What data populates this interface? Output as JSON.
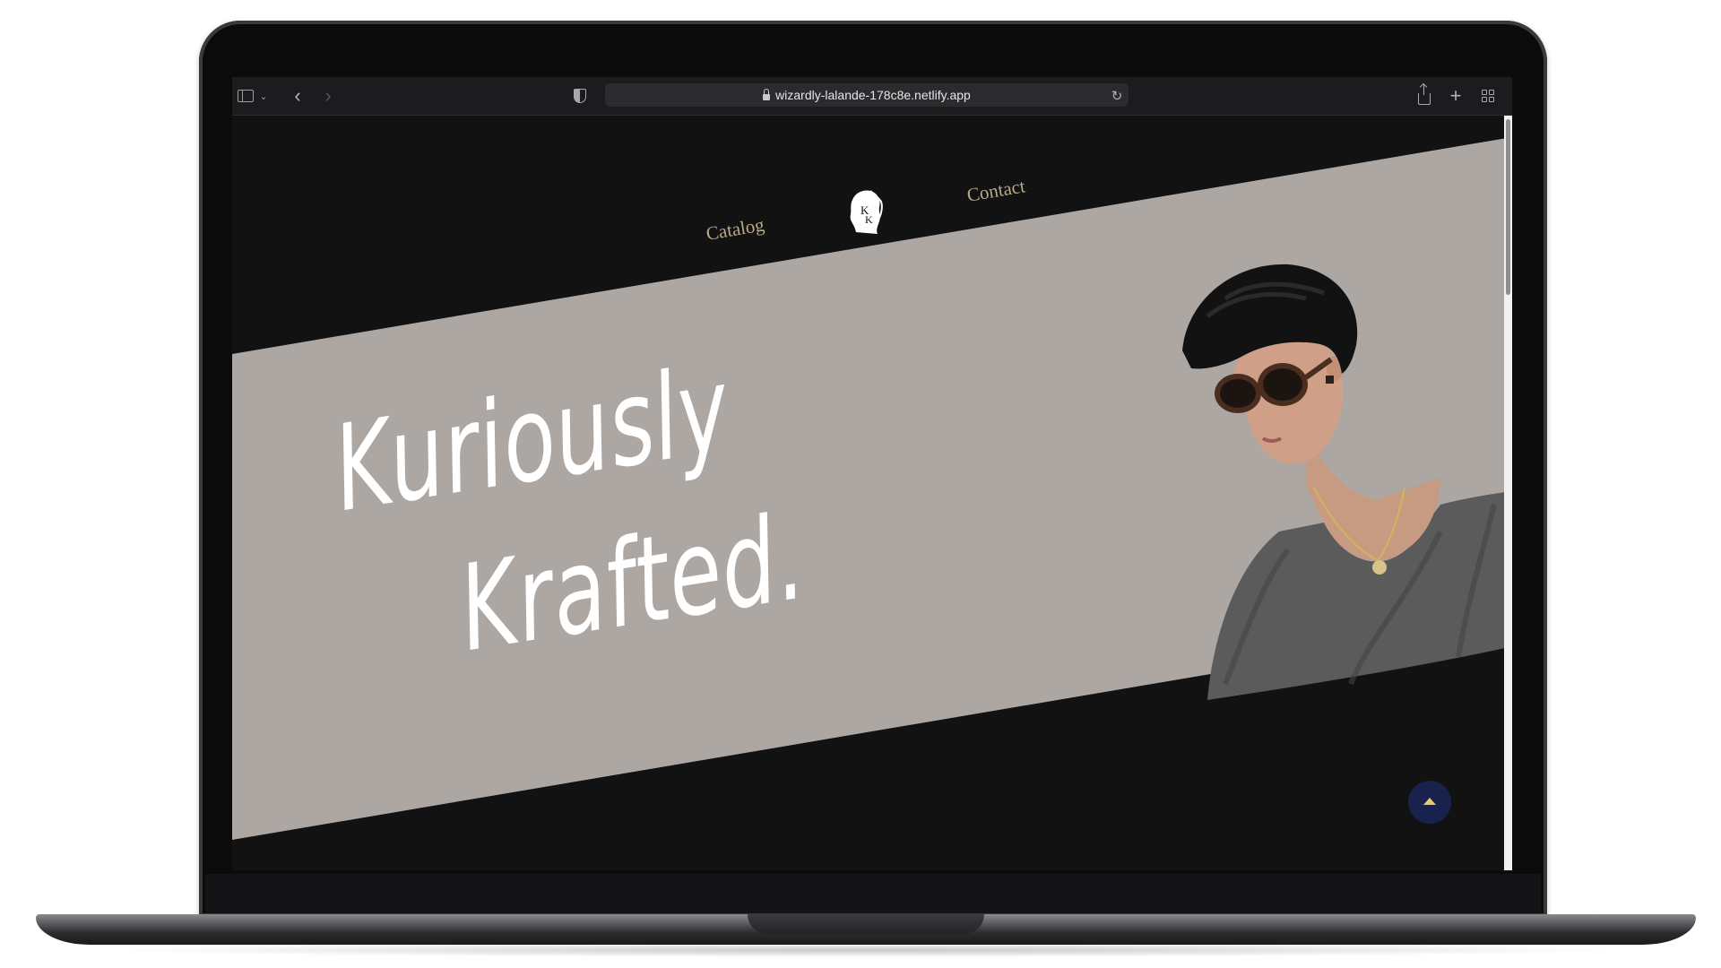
{
  "browser": {
    "url": "wizardly-lalande-178c8e.netlify.app",
    "icons": {
      "sidebar": "sidebar-icon",
      "sidebar_menu": "chevron-down-icon",
      "back": "chevron-left-icon",
      "forward": "chevron-right-icon",
      "privacy": "shield-icon",
      "secure": "lock-icon",
      "reload": "reload-icon",
      "share": "share-icon",
      "new_tab": "plus-icon",
      "tabs_overview": "grid-icon"
    }
  },
  "site": {
    "nav": {
      "catalog": "Catalog",
      "contact": "Contact",
      "logo_monogram": "KK"
    },
    "hero": {
      "line1": "Kuriously",
      "line2": "Krafted."
    },
    "scroll_top_icon": "arrow-up-icon"
  },
  "colors": {
    "page_background": "#121212",
    "band": "#ada7a4",
    "nav_text": "#b9ab86",
    "headline": "#ffffff",
    "scroll_button": "#18224d",
    "scroll_arrow": "#e8cb6a"
  }
}
